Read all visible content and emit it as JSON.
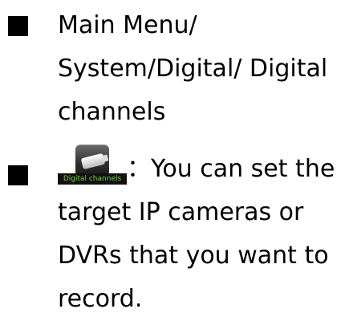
{
  "bullets": [
    {
      "lines": [
        "Main Menu/",
        "System/Digital/ Digital",
        "channels"
      ]
    },
    {
      "icon": {
        "name": "digital-channels-icon",
        "label": "Digital channels",
        "label_color": "#7cd23a"
      },
      "first_line_suffix": "：You can set the",
      "lines": [
        "target IP cameras or",
        "DVRs that you want to",
        "record."
      ]
    }
  ]
}
